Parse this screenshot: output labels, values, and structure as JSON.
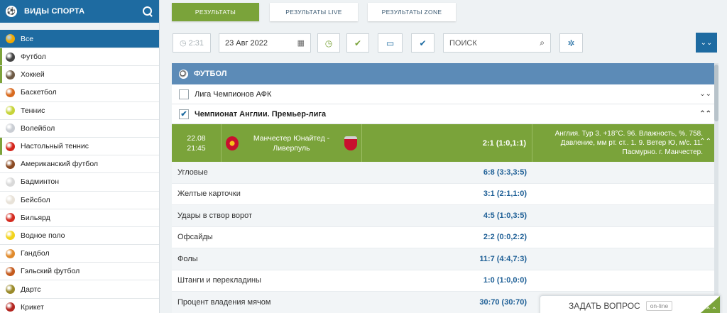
{
  "sidebar": {
    "title": "ВИДЫ СПОРТА",
    "items": [
      {
        "label": "Все",
        "color": "#f2a900"
      },
      {
        "label": "Футбол",
        "color": "#444444"
      },
      {
        "label": "Хоккей",
        "color": "#6d5a45"
      },
      {
        "label": "Баскетбол",
        "color": "#d86a1f"
      },
      {
        "label": "Теннис",
        "color": "#c7d43a"
      },
      {
        "label": "Волейбол",
        "color": "#c9cdd3"
      },
      {
        "label": "Настольный теннис",
        "color": "#d4261c"
      },
      {
        "label": "Американский футбол",
        "color": "#8a4a22"
      },
      {
        "label": "Бадминтон",
        "color": "#d9d9d9"
      },
      {
        "label": "Бейсбол",
        "color": "#e8e2d8"
      },
      {
        "label": "Бильярд",
        "color": "#d42b20"
      },
      {
        "label": "Водное поло",
        "color": "#f2d31b"
      },
      {
        "label": "Гандбол",
        "color": "#e08a2c"
      },
      {
        "label": "Гэльский футбол",
        "color": "#c45a1d"
      },
      {
        "label": "Дартс",
        "color": "#9a8a2a"
      },
      {
        "label": "Крикет",
        "color": "#b32620"
      }
    ]
  },
  "tabs": {
    "results": "РЕЗУЛЬТАТЫ",
    "results_live": "РЕЗУЛЬТАТЫ LIVE",
    "results_zone": "РЕЗУЛЬТАТЫ ZONE"
  },
  "controls": {
    "time": "2:31",
    "date": "23 Авг 2022",
    "search_placeholder": "ПОИСК"
  },
  "section": {
    "title": "ФУТБОЛ"
  },
  "leagues": [
    {
      "name": "Лига Чемпионов АФК",
      "checked": false
    },
    {
      "name": "Чемпионат Англии. Премьер-лига",
      "checked": true
    }
  ],
  "match": {
    "date": "22.08",
    "time": "21:45",
    "teams": "Манчестер Юнайтед - Ливерпуль",
    "score": "2:1 (1:0,1:1)",
    "info_line1": "Англия. Тур 3. +18°С. 96. Влажность, %. 758.",
    "info_line2": "Давление, мм рт. ст.. 1. 9. Ветер Ю, м/с. 11.",
    "info_line3": "Пасмурно. г. Манчестер."
  },
  "stats": [
    {
      "label": "Угловые",
      "value": "6:8 (3:3,3:5)"
    },
    {
      "label": "Желтые карточки",
      "value": "3:1 (2:1,1:0)"
    },
    {
      "label": "Удары в створ ворот",
      "value": "4:5 (1:0,3:5)"
    },
    {
      "label": "Офсайды",
      "value": "2:2 (0:0,2:2)"
    },
    {
      "label": "Фолы",
      "value": "11:7 (4:4,7:3)"
    },
    {
      "label": "Штанги и перекладины",
      "value": "1:0 (1:0,0:0)"
    },
    {
      "label": "Процент владения мячом",
      "value": "30:70 (30:70)"
    }
  ],
  "ask": {
    "label": "ЗАДАТЬ ВОПРОС",
    "status": "on-line"
  },
  "colors": {
    "brand_blue": "#1e6ba1",
    "accent_green": "#7aa33a",
    "section_blue": "#5c8bb7"
  }
}
